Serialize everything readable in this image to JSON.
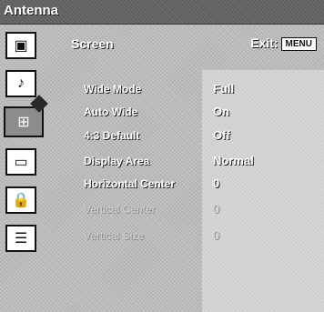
{
  "header": {
    "title": "Antenna"
  },
  "sidebar": {
    "icons": [
      {
        "name": "picture-icon",
        "glyph": "▣"
      },
      {
        "name": "sound-icon",
        "glyph": "♪"
      },
      {
        "name": "screen-icon",
        "glyph": "⊞",
        "selected": true
      },
      {
        "name": "channel-icon",
        "glyph": "▭"
      },
      {
        "name": "parental-lock-icon",
        "glyph": "🔒"
      },
      {
        "name": "setup-icon",
        "glyph": "☰"
      }
    ]
  },
  "main": {
    "title": "Screen",
    "exit_label": "Exit:",
    "exit_key": "MENU",
    "rows": [
      {
        "label": "Wide Mode",
        "value": "Full",
        "enabled": true
      },
      {
        "label": "Auto Wide",
        "value": "On",
        "enabled": true
      },
      {
        "label": "4:3 Default",
        "value": "Off",
        "enabled": true
      },
      {
        "label": "Display Area",
        "value": "Normal",
        "enabled": true
      },
      {
        "label": "Horizontal Center",
        "value": "0",
        "enabled": true
      },
      {
        "label": "Vertical Center",
        "value": "0",
        "enabled": false
      },
      {
        "label": "Vertical Size",
        "value": "0",
        "enabled": false
      }
    ]
  },
  "colors": {
    "panel_bg": "#bdbdbd",
    "topbar_bg": "#6a6a6a",
    "text": "#ffffff"
  }
}
